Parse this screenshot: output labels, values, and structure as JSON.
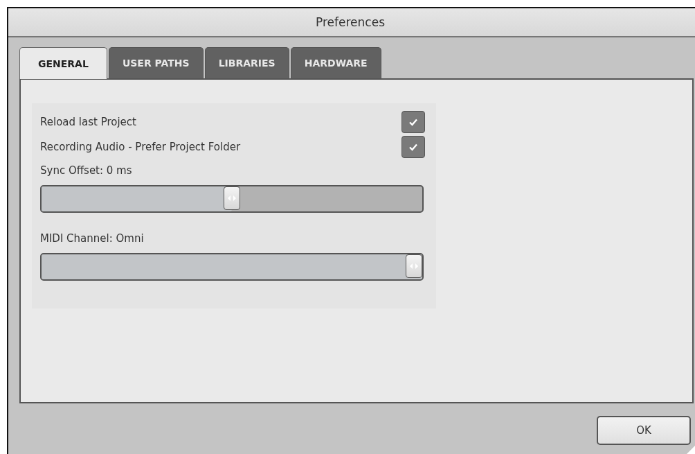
{
  "window": {
    "title": "Preferences"
  },
  "tabs": [
    {
      "label": "GENERAL",
      "selected": true
    },
    {
      "label": "USER PATHS",
      "selected": false
    },
    {
      "label": "LIBRARIES",
      "selected": false
    },
    {
      "label": "HARDWARE",
      "selected": false
    }
  ],
  "settings": [
    {
      "kind": "checkbox",
      "label": "Reload last Project",
      "checked": true
    },
    {
      "kind": "checkbox",
      "label": "Recording Audio - Prefer Project Folder",
      "checked": true
    },
    {
      "kind": "slider",
      "label": "Sync Offset: 0 ms",
      "level": 0.5
    },
    {
      "kind": "slider",
      "label": "MIDI Channel: Omni",
      "level": 1
    }
  ],
  "buttons": [
    "OK"
  ]
}
